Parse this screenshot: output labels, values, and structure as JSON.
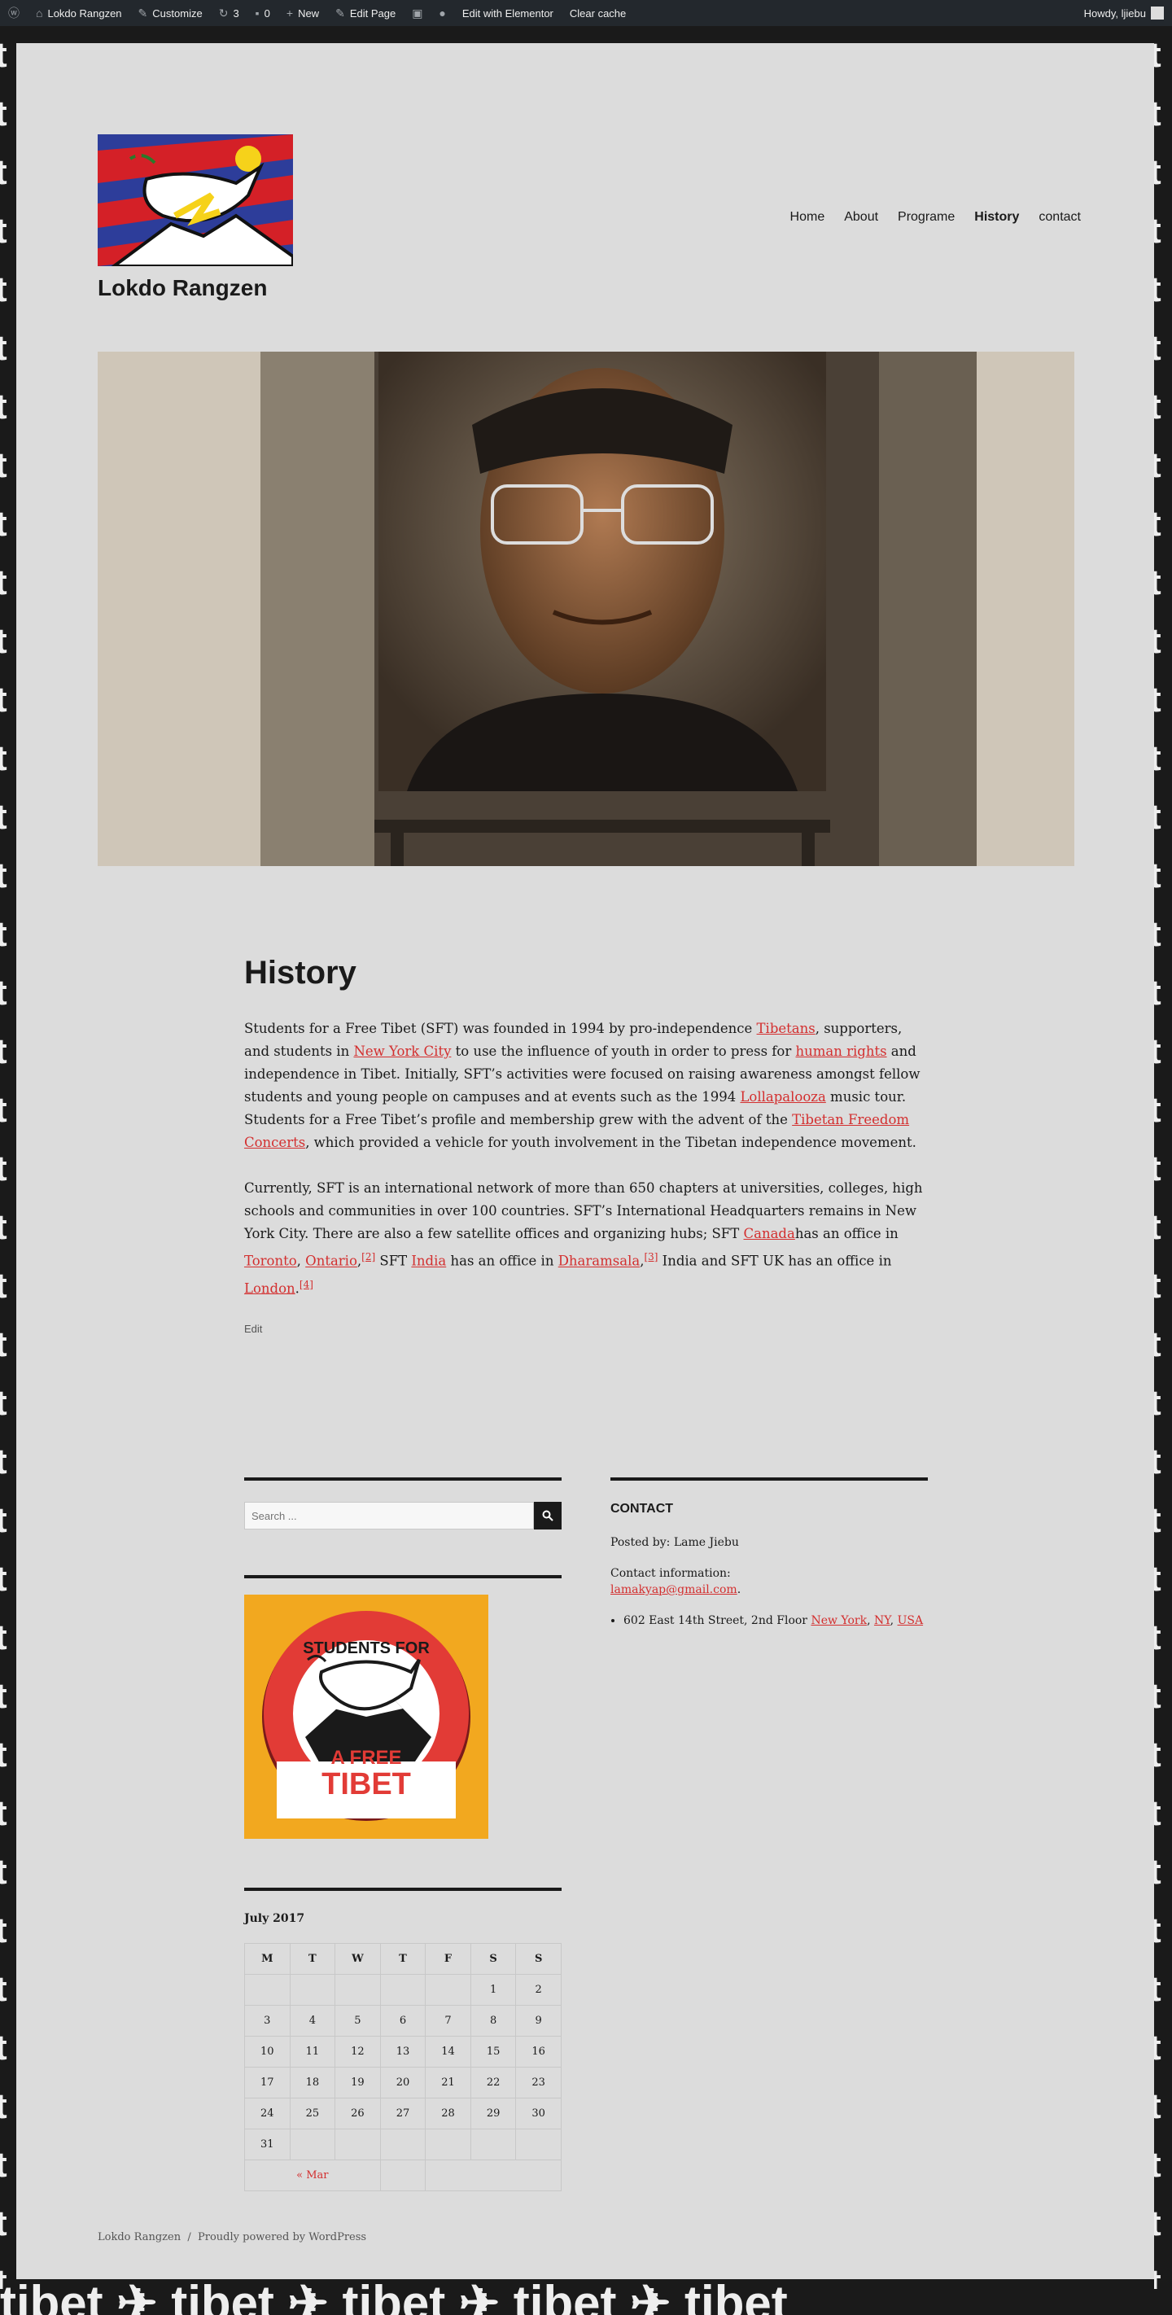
{
  "admin_bar": {
    "site_name": "Lokdo Rangzen",
    "customize": "Customize",
    "updates_count": "3",
    "comments_count": "0",
    "new": "New",
    "edit_page": "Edit Page",
    "edit_with_elementor": "Edit with Elementor",
    "clear_cache": "Clear cache",
    "howdy": "Howdy, ljiebu"
  },
  "background": {
    "left_letter": "t",
    "bottom_text": "tibet  ✈  tibet  ✈  tibet  ✈  tibet  ✈  tibet"
  },
  "site": {
    "title": "Lokdo Rangzen"
  },
  "nav": {
    "items": [
      "Home",
      "About",
      "Programe",
      "History",
      "contact"
    ],
    "active": "History"
  },
  "content": {
    "title": "History",
    "p1": {
      "t1": "Students for a Free Tibet (SFT) was founded in 1994 by pro-independence ",
      "l1": "Tibetans",
      "t2": ", supporters, and students in ",
      "l2": "New York City",
      "t3": " to use the influence of youth in order to press for ",
      "l3": "human rights",
      "t4": " and independence in Tibet. Initially, SFT’s activities were focused on raising awareness amongst fellow students and young people on campuses and at events such as the 1994 ",
      "l4": "Lollapalooza",
      "t5": " music tour. Students for a Free Tibet’s profile and membership grew with the advent of the ",
      "l5": "Tibetan Freedom Concerts",
      "t6": ", which provided a vehicle for youth involvement in the Tibetan independence movement."
    },
    "p2": {
      "t1": "Currently, SFT is an international network of more than 650 chapters at universities, colleges, high schools and communities in over 100 countries. SFT’s International Headquarters remains in New York City. There are also a few satellite offices and organizing hubs; SFT ",
      "l1": "Canada",
      "t2": "has an office in ",
      "l2": "Toronto",
      "t3": ", ",
      "l3": "Ontario",
      "t4": ",",
      "ref2": "[2]",
      "t5": " SFT ",
      "l4": "India",
      "t6": " has an office in ",
      "l5": "Dharamsala",
      "t7": ",",
      "ref3": "[3]",
      "t8": " India and SFT UK has an office in ",
      "l6": "London",
      "t9": ".",
      "ref4": "[4]"
    },
    "edit": "Edit"
  },
  "search": {
    "placeholder": "Search ..."
  },
  "calendar": {
    "caption": "July 2017",
    "headers": [
      "M",
      "T",
      "W",
      "T",
      "F",
      "S",
      "S"
    ],
    "rows": [
      [
        "",
        "",
        "",
        "",
        "",
        "1",
        "2"
      ],
      [
        "3",
        "4",
        "5",
        "6",
        "7",
        "8",
        "9"
      ],
      [
        "10",
        "11",
        "12",
        "13",
        "14",
        "15",
        "16"
      ],
      [
        "17",
        "18",
        "19",
        "20",
        "21",
        "22",
        "23"
      ],
      [
        "24",
        "25",
        "26",
        "27",
        "28",
        "29",
        "30"
      ],
      [
        "31",
        "",
        "",
        "",
        "",
        "",
        ""
      ]
    ],
    "prev": "« Mar"
  },
  "contact": {
    "title": "CONTACT",
    "posted_by": "Posted by: Lame Jiebu",
    "info_label": "Contact information:",
    "email": "lamakyap@gmail.com",
    "email_suffix": ".",
    "address": "602 East 14th Street, 2nd Floor ",
    "city": "New York",
    "state": "NY",
    "country": "USA",
    "sep": ", "
  },
  "badge": {
    "line1": "STUDENTS FOR",
    "line2": "A FREE",
    "line3": "TIBET"
  },
  "footer": {
    "site": "Lokdo Rangzen",
    "sep": "/",
    "powered": "Proudly powered by WordPress"
  },
  "colors": {
    "link": "#d32f2f",
    "page_bg": "#dcdcdc",
    "admin_bar": "#23282d"
  }
}
